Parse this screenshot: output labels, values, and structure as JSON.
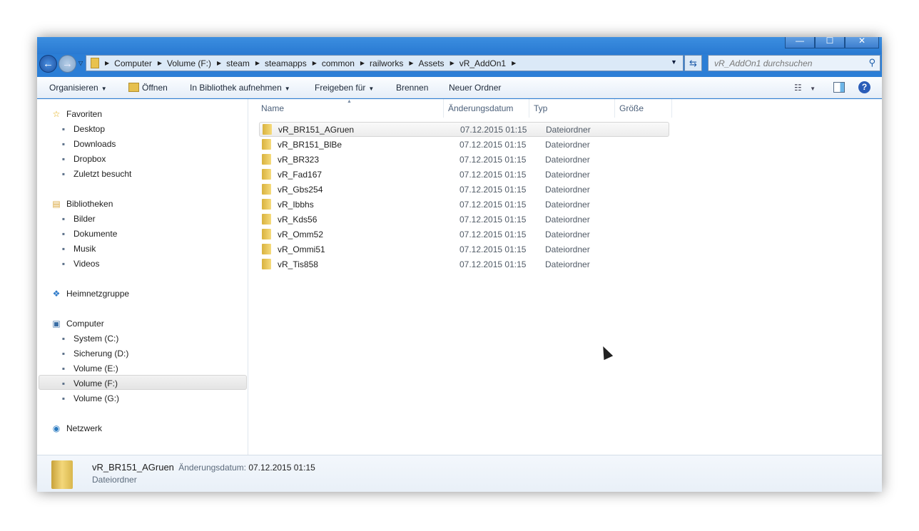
{
  "window": {
    "controls": [
      "—",
      "☐",
      "✕"
    ]
  },
  "address": {
    "crumbs": [
      "Computer",
      "Volume (F:)",
      "steam",
      "steamapps",
      "common",
      "railworks",
      "Assets",
      "vR_AddOn1"
    ]
  },
  "search": {
    "placeholder": "vR_AddOn1 durchsuchen"
  },
  "toolbar": {
    "organize": "Organisieren",
    "open": "Öffnen",
    "library": "In Bibliothek aufnehmen",
    "share": "Freigeben für",
    "burn": "Brennen",
    "new_folder": "Neuer Ordner",
    "help": "?"
  },
  "sidebar": {
    "favorites": {
      "label": "Favoriten",
      "items": [
        "Desktop",
        "Downloads",
        "Dropbox",
        "Zuletzt besucht"
      ]
    },
    "libraries": {
      "label": "Bibliotheken",
      "items": [
        "Bilder",
        "Dokumente",
        "Musik",
        "Videos"
      ]
    },
    "homegroup": {
      "label": "Heimnetzgruppe"
    },
    "computer": {
      "label": "Computer",
      "items": [
        "System (C:)",
        "Sicherung (D:)",
        "Volume (E:)",
        "Volume (F:)",
        "Volume (G:)"
      ],
      "selected": "Volume (F:)"
    },
    "network": {
      "label": "Netzwerk"
    }
  },
  "columns": {
    "name": "Name",
    "date": "Änderungsdatum",
    "type": "Typ",
    "size": "Größe"
  },
  "files": [
    {
      "name": "vR_BR151_AGruen",
      "date": "07.12.2015 01:15",
      "type": "Dateiordner"
    },
    {
      "name": "vR_BR151_BlBe",
      "date": "07.12.2015 01:15",
      "type": "Dateiordner"
    },
    {
      "name": "vR_BR323",
      "date": "07.12.2015 01:15",
      "type": "Dateiordner"
    },
    {
      "name": "vR_Fad167",
      "date": "07.12.2015 01:15",
      "type": "Dateiordner"
    },
    {
      "name": "vR_Gbs254",
      "date": "07.12.2015 01:15",
      "type": "Dateiordner"
    },
    {
      "name": "vR_Ibbhs",
      "date": "07.12.2015 01:15",
      "type": "Dateiordner"
    },
    {
      "name": "vR_Kds56",
      "date": "07.12.2015 01:15",
      "type": "Dateiordner"
    },
    {
      "name": "vR_Omm52",
      "date": "07.12.2015 01:15",
      "type": "Dateiordner"
    },
    {
      "name": "vR_Ommi51",
      "date": "07.12.2015 01:15",
      "type": "Dateiordner"
    },
    {
      "name": "vR_Tis858",
      "date": "07.12.2015 01:15",
      "type": "Dateiordner"
    }
  ],
  "status": {
    "name": "vR_BR151_AGruen",
    "date_label": "Änderungsdatum:",
    "date": "07.12.2015 01:15",
    "type": "Dateiordner"
  }
}
